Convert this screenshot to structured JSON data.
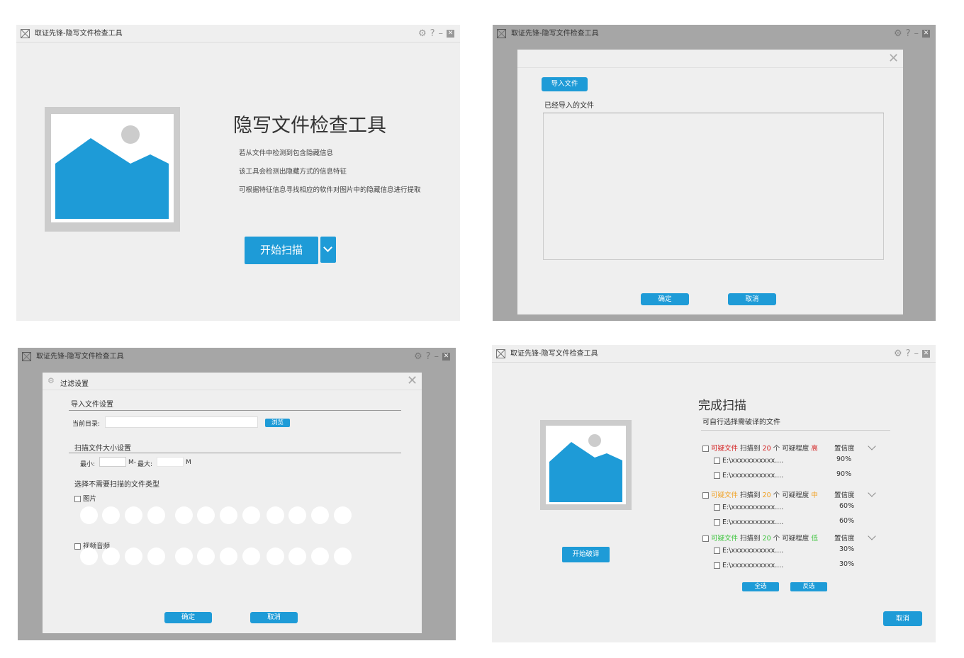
{
  "window": {
    "title": "取证先锋-隐写文件检查工具"
  },
  "screen1": {
    "heading": "隐写文件检查工具",
    "descriptions": [
      "若从文件中检测到包含隐藏信息",
      "该工具会检测出隐藏方式的信息特征",
      "可根据特征信息寻找相应的软件对图片中的隐藏信息进行提取"
    ],
    "start_scan_label": "开始扫描"
  },
  "screen2": {
    "import_button": "导入文件",
    "imported_label": "已经导入的文件",
    "ok": "确定",
    "cancel": "取消"
  },
  "screen3": {
    "dialog_title": "过滤设置",
    "import_section": "导入文件设置",
    "current_dir_label": "当前目录:",
    "browse": "浏览",
    "size_section": "扫描文件大小设置",
    "min_label": "最小:",
    "min_unit": "M-",
    "max_label": "最大:",
    "max_unit": "M",
    "exclude_section": "选择不需要扫描的文件类型",
    "type_image": "图片",
    "type_av": "视频音频",
    "ok": "确定",
    "cancel": "取消"
  },
  "screen4": {
    "heading": "完成扫描",
    "subheading": "可自行选择需破译的文件",
    "start_crack": "开始破译",
    "select_all": "全选",
    "invert": "反选",
    "cancel": "取消",
    "groups": [
      {
        "label": "可疑文件",
        "scan_text": "扫描到",
        "count": "20",
        "unit": "个",
        "level_label": "可疑程度",
        "level": "高",
        "color": "#d42020",
        "conf_label": "置信度",
        "files": [
          {
            "path": "E:\\xxxxxxxxxxx....",
            "pct": "90%"
          },
          {
            "path": "E:\\xxxxxxxxxxx....",
            "pct": "90%"
          }
        ]
      },
      {
        "label": "可疑文件",
        "scan_text": "扫描到",
        "count": "20",
        "unit": "个",
        "level_label": "可疑程度",
        "level": "中",
        "color": "#f0a020",
        "conf_label": "置信度",
        "files": [
          {
            "path": "E:\\xxxxxxxxxxx....",
            "pct": "60%"
          },
          {
            "path": "E:\\xxxxxxxxxxx....",
            "pct": "60%"
          }
        ]
      },
      {
        "label": "可疑文件",
        "scan_text": "扫描到",
        "count": "20",
        "unit": "个",
        "level_label": "可疑程度",
        "level": "低",
        "color": "#3cc43c",
        "conf_label": "置信度",
        "files": [
          {
            "path": "E:\\xxxxxxxxxxx....",
            "pct": "30%"
          },
          {
            "path": "E:\\xxxxxxxxxxx....",
            "pct": "30%"
          }
        ]
      }
    ]
  },
  "colors": {
    "accent": "#1e9bd7",
    "panel": "#efefef",
    "overlay": "#a6a6a6",
    "placeholder": "#cccccc"
  }
}
